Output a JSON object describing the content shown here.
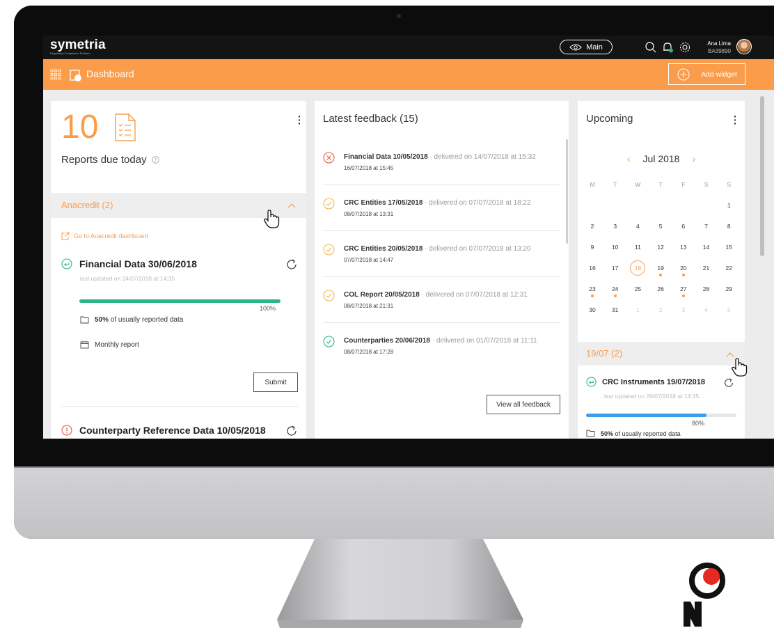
{
  "colors": {
    "accent": "#fb9c4a",
    "success": "#2db38a",
    "error": "#e5574a",
    "info": "#3f9be8"
  },
  "topbar": {
    "logo": "symetria",
    "logo_sub": "Regulatory Compliance Platform",
    "environment": "Main",
    "user_name": "Ana Lima",
    "user_id": "BA39890"
  },
  "orangebar": {
    "title": "Dashboard",
    "add_widget": "Add widget"
  },
  "reports": {
    "count": "10",
    "label": "Reports due today",
    "group": {
      "label": "Anacredit (2)",
      "dashboard_link": "Go to Anacredit dashboard",
      "items": [
        {
          "title": "Financial Data 30/06/2018",
          "updated": "last updated on 24/07/2018 at 14:35",
          "progress": 100,
          "progress_label": "100%",
          "usual_pct": "50%",
          "usual_text": "of usually reported data",
          "frequency": "Monthly report",
          "submit": "Submit"
        },
        {
          "title": "Counterparty Reference Data 10/05/2018"
        }
      ]
    }
  },
  "feedback": {
    "title": "Latest feedback (15)",
    "items": [
      {
        "status": "error",
        "name": "Financial Data 10/05/2018",
        "delivered": "delivered on 14/07/2018 at 15:32",
        "date": "16/07/2018 at 15:45"
      },
      {
        "status": "warning",
        "name": "CRC Entities 17/05/2018",
        "delivered": "delivered on 07/07/2018 at 18:22",
        "date": "08/07/2018 at 13:31"
      },
      {
        "status": "warning",
        "name": "CRC Entities 20/05/2018",
        "delivered": "delivered on 07/07/2018 at 13:20",
        "date": "07/07/2018 at 14:47"
      },
      {
        "status": "warning",
        "name": "COL Report 20/05/2018",
        "delivered": "delivered on 07/07/2018 at 12:31",
        "date": "08/07/2018 at 21:31"
      },
      {
        "status": "success",
        "name": "Counterparties 20/06/2018",
        "delivered": "delivered on 01/07/2018 at 11:11",
        "date": "08/07/2018 at 17:28"
      }
    ],
    "separator": "·",
    "view_all": "View all feedback"
  },
  "upcoming": {
    "title": "Upcoming",
    "month": "Jul 2018",
    "weekdays": [
      "M",
      "T",
      "W",
      "T",
      "F",
      "S",
      "S"
    ],
    "today": "18",
    "event_days": [
      "19",
      "20",
      "23",
      "24",
      "27"
    ],
    "group": {
      "label": "19/07 (2)",
      "item_title": "CRC Instruments 19/07/2018",
      "updated": "last updated on 20/07/2018 at 14:35",
      "progress": 80,
      "progress_label": "80%",
      "usual_pct": "50%",
      "usual_text": "of usually reported data"
    }
  }
}
